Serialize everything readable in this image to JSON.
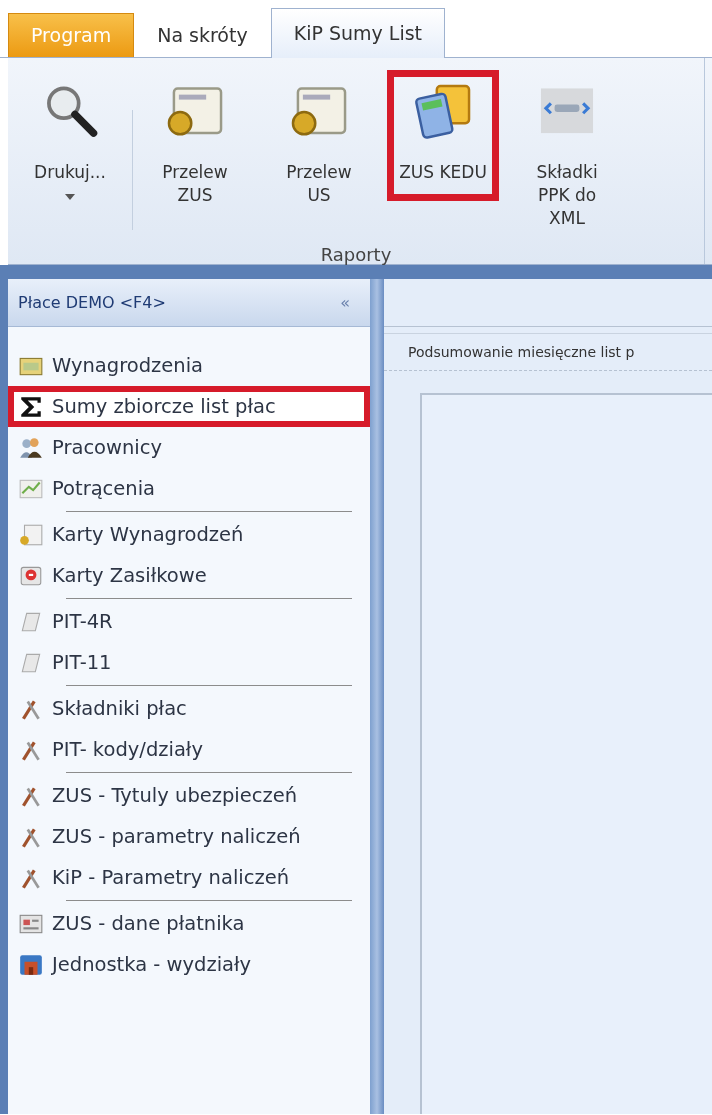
{
  "tabs": [
    {
      "label": "Program",
      "kind": "app",
      "selected": false
    },
    {
      "label": "Na skróty",
      "kind": "normal",
      "selected": false
    },
    {
      "label": "KiP Sumy List",
      "kind": "normal",
      "selected": true
    }
  ],
  "ribbon": {
    "group_label": "Raporty",
    "buttons": [
      {
        "label": "Drukuj...",
        "dropdown": true,
        "separator_after": true,
        "highlighted": false
      },
      {
        "label": "Przelew ZUS",
        "dropdown": false,
        "separator_after": false,
        "highlighted": false
      },
      {
        "label": "Przelew US",
        "dropdown": false,
        "separator_after": false,
        "highlighted": false
      },
      {
        "label": "ZUS KEDU",
        "dropdown": false,
        "separator_after": false,
        "highlighted": true
      },
      {
        "label": "Składki PPK do XML",
        "dropdown": false,
        "separator_after": false,
        "highlighted": false
      }
    ]
  },
  "sidebar": {
    "title": "Płace DEMO <F4>",
    "collapse": "«",
    "items": [
      {
        "label": "Wynagrodzenia",
        "separator_after": false,
        "highlighted": false
      },
      {
        "label": "Sumy zbiorcze list płac",
        "separator_after": false,
        "highlighted": true
      },
      {
        "label": "Pracownicy",
        "separator_after": false,
        "highlighted": false
      },
      {
        "label": "Potrącenia",
        "separator_after": true,
        "highlighted": false
      },
      {
        "label": "Karty Wynagrodzeń",
        "separator_after": false,
        "highlighted": false
      },
      {
        "label": "Karty Zasiłkowe",
        "separator_after": true,
        "highlighted": false
      },
      {
        "label": "PIT-4R",
        "separator_after": false,
        "highlighted": false
      },
      {
        "label": "PIT-11",
        "separator_after": true,
        "highlighted": false
      },
      {
        "label": "Składniki płac",
        "separator_after": false,
        "highlighted": false
      },
      {
        "label": "PIT- kody/działy",
        "separator_after": true,
        "highlighted": false
      },
      {
        "label": "ZUS - Tytuly ubezpieczeń",
        "separator_after": false,
        "highlighted": false
      },
      {
        "label": "ZUS - parametry naliczeń",
        "separator_after": false,
        "highlighted": false
      },
      {
        "label": "KiP - Parametry naliczeń",
        "separator_after": true,
        "highlighted": false
      },
      {
        "label": "ZUS - dane płatnika",
        "separator_after": false,
        "highlighted": false
      },
      {
        "label": "Jednostka - wydziały",
        "separator_after": false,
        "highlighted": false
      }
    ]
  },
  "content": {
    "tab_label": "Podsumowanie miesięczne list p"
  }
}
